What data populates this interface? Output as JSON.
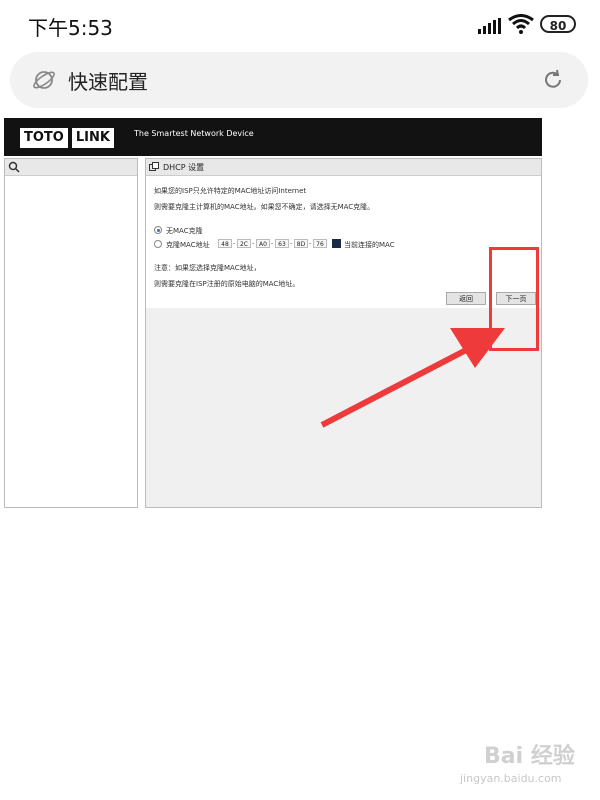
{
  "status_bar": {
    "time": "下午5:53",
    "battery": "80"
  },
  "address_bar": {
    "title": "快速配置"
  },
  "router": {
    "logo_left": "TOTO",
    "logo_right": "LINK",
    "slogan": "The Smartest Network Device",
    "panel_title": "DHCP 设置",
    "intro_line1": "如果您的ISP只允许特定的MAC地址访问Internet",
    "intro_line2": "则需要克隆主计算机的MAC地址。如果您不确定，请选择无MAC克隆。",
    "option_no_clone": "无MAC克隆",
    "option_clone": "克隆MAC地址",
    "mac": [
      "48",
      "2C",
      "A0",
      "63",
      "8D",
      "76"
    ],
    "current_mac_label": "当前连接的MAC",
    "note_line1": "注意：如果您选择克隆MAC地址，",
    "note_line2": "则需要克隆在ISP注册的原始电脑的MAC地址。",
    "back_button": "返回",
    "next_button": "下一页"
  },
  "watermark": {
    "brand": "Bai 经验",
    "url": "jingyan.baidu.com"
  },
  "colors": {
    "highlight": "#ee3a3a",
    "topbar": "#121212"
  }
}
